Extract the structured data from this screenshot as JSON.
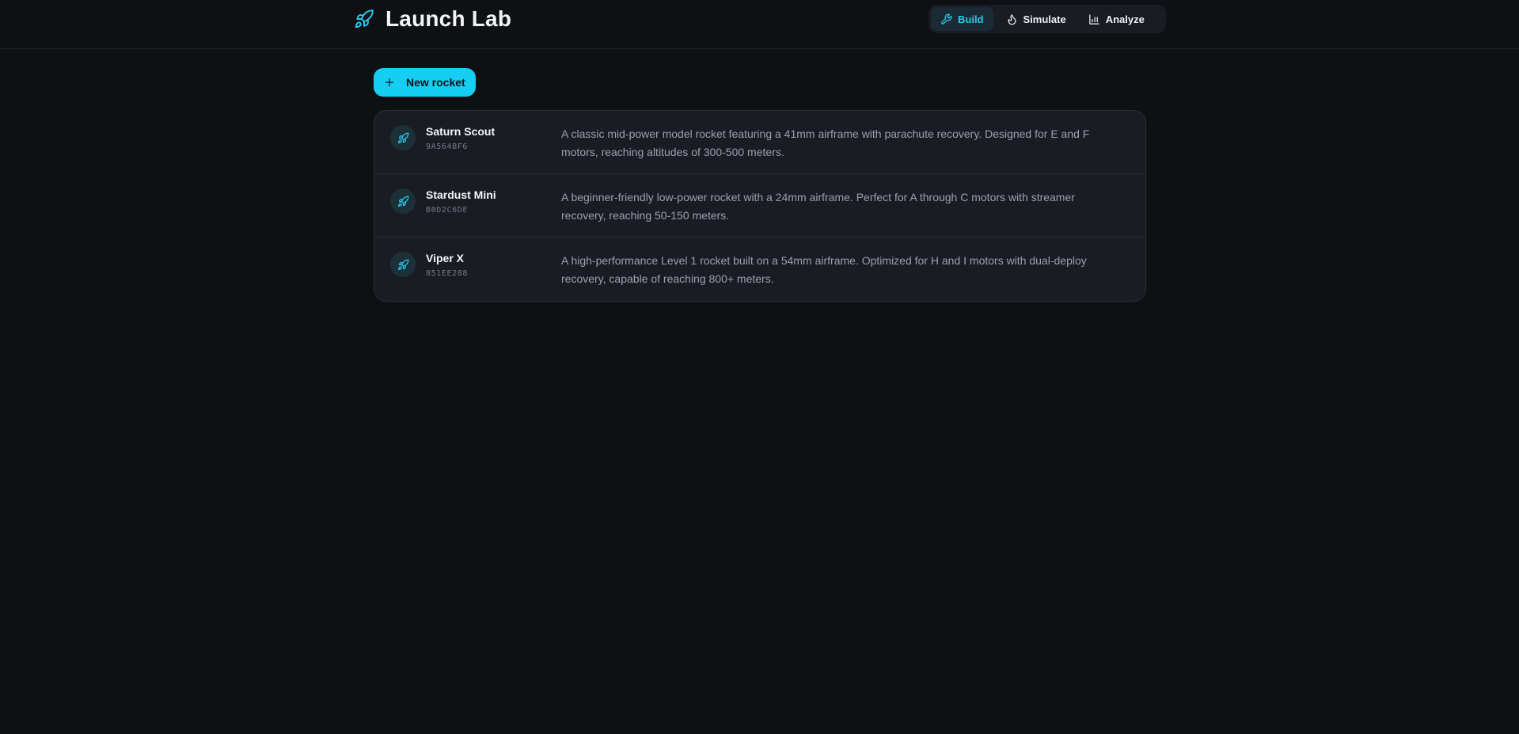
{
  "app": {
    "title": "Launch Lab",
    "accent_color": "#16cdf2"
  },
  "nav": {
    "tabs": [
      {
        "label": "Build",
        "icon": "wrench-icon",
        "active": true
      },
      {
        "label": "Simulate",
        "icon": "flame-icon",
        "active": false
      },
      {
        "label": "Analyze",
        "icon": "bar-chart-icon",
        "active": false
      }
    ]
  },
  "toolbar": {
    "new_label": "New rocket"
  },
  "rockets": [
    {
      "name": "Saturn Scout",
      "id": "9A564BF6",
      "description": "A classic mid-power model rocket featuring a 41mm airframe with parachute recovery. Designed for E and F motors, reaching altitudes of 300-500 meters."
    },
    {
      "name": "Stardust Mini",
      "id": "B0D2C6DE",
      "description": "A beginner-friendly low-power rocket with a 24mm airframe. Perfect for A through C motors with streamer recovery, reaching 50-150 meters."
    },
    {
      "name": "Viper X",
      "id": "851EE288",
      "description": "A high-performance Level 1 rocket built on a 54mm airframe. Optimized for H and I motors with dual-deploy recovery, capable of reaching 800+ meters."
    }
  ]
}
